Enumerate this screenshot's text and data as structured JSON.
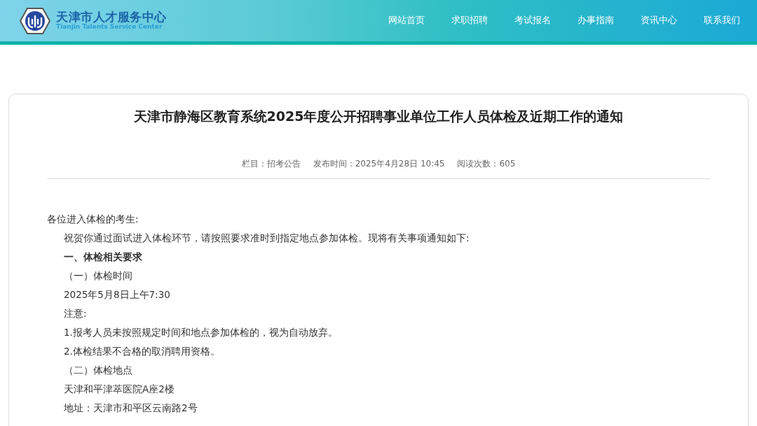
{
  "header": {
    "logo_title": "天津市人才服务中心",
    "logo_subtitle": "Tianjin Talents Service Center",
    "nav": [
      {
        "label": "网站首页"
      },
      {
        "label": "求职招聘"
      },
      {
        "label": "考试报名"
      },
      {
        "label": "办事指南"
      },
      {
        "label": "资讯中心"
      },
      {
        "label": "联系我们"
      }
    ]
  },
  "article": {
    "title": "天津市静海区教育系统2025年度公开招聘事业单位工作人员体检及近期工作的通知",
    "meta": [
      "栏目：招考公告",
      "发布时间：2025年4月28日 10:45",
      "阅读次数：605"
    ],
    "paragraphs": [
      {
        "kind": "plain",
        "text": "各位进入体检的考生:"
      },
      {
        "kind": "indent",
        "text": "祝贺你通过面试进入体检环节，请按照要求准时到指定地点参加体检。现将有关事项通知如下:"
      },
      {
        "kind": "heading",
        "text": "一、体检相关要求"
      },
      {
        "kind": "indent",
        "text": "（一）体检时间"
      },
      {
        "kind": "indent",
        "text": "2025年5月8日上午7:30"
      },
      {
        "kind": "indent",
        "text": "注意:"
      },
      {
        "kind": "indent",
        "text": "1.报考人员未按照规定时间和地点参加体检的，视为自动放弃。"
      },
      {
        "kind": "indent",
        "text": "2.体检结果不合格的取消聘用资格。"
      },
      {
        "kind": "indent",
        "text": "（二）体检地点"
      },
      {
        "kind": "indent",
        "text": "天津和平津萃医院A座2楼"
      },
      {
        "kind": "indent",
        "text": "地址：天津市和平区云南路2号"
      }
    ]
  }
}
